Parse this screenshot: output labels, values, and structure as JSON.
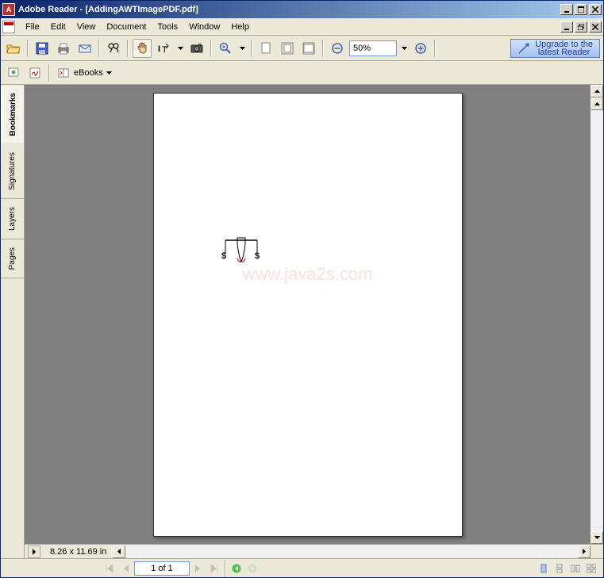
{
  "titlebar": {
    "app": "Adobe Reader",
    "document": "[AddingAWTImagePDF.pdf]"
  },
  "menubar": {
    "items": [
      "File",
      "Edit",
      "View",
      "Document",
      "Tools",
      "Window",
      "Help"
    ]
  },
  "toolbar": {
    "zoom_value": "50%",
    "upgrade_line1": "Upgrade to the",
    "upgrade_line2": "latest Reader",
    "ebooks": "eBooks"
  },
  "sidebar": {
    "tabs": [
      "Bookmarks",
      "Signatures",
      "Layers",
      "Pages"
    ],
    "active": 0
  },
  "page": {
    "watermark": "www.java2s.com",
    "dimensions": "8.26 x 11.69 in"
  },
  "statusbar": {
    "page_display": "1 of 1"
  },
  "icons": {
    "open": "open-icon",
    "save": "save-icon",
    "print": "print-icon",
    "email": "email-icon",
    "search": "search-icon",
    "hand": "hand-icon",
    "select": "select-icon",
    "snapshot": "snapshot-icon",
    "zoomin": "zoomin-icon",
    "zoomout": "zoomout-icon",
    "helpq": "help-icon"
  }
}
